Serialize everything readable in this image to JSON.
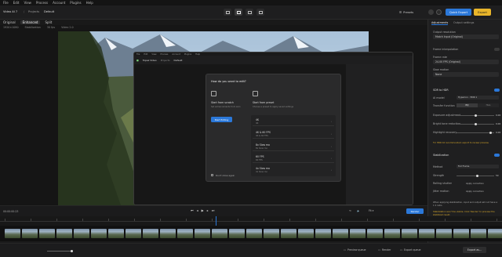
{
  "menubar": {
    "items": [
      "File",
      "Edit",
      "View",
      "Process",
      "Account",
      "Plugins",
      "Help"
    ]
  },
  "toolbar": {
    "project": "Video AI 7",
    "crumb_sep": "/",
    "crumb_projects": "Projects",
    "crumb_current": "Default",
    "presets_label": "Presets",
    "quick_export_label": "Quick Export",
    "export_label": "Export"
  },
  "subtabs": {
    "items": [
      "Original",
      "Enhanced",
      "Split"
    ]
  },
  "infobar": {
    "text": [
      "1920×1080",
      "Stabilization",
      "30 fps",
      "Video 2.0"
    ]
  },
  "sidebar": {
    "tabs": [
      "Adjustments",
      "Output settings"
    ],
    "output_resolution_label": "Output resolution",
    "output_resolution_value": "Match Input (Original)",
    "frame_interpolation_label": "Frame interpolation",
    "frame_rate_label": "Frame rate",
    "frame_rate_value": "24.00 FPS (Original)",
    "slow_motion_label": "Slow motion",
    "slow_motion_value": "None",
    "sdr_hdr_label": "SDR to HDR",
    "ai_model_label": "AI model",
    "ai_model_value": "Hyperion · HDR 1",
    "transfer_label": "Transfer function",
    "transfer_options": [
      "PQ",
      "HLG"
    ],
    "sliders": [
      {
        "label": "Exposure adjustment",
        "value": "0.00",
        "level": 0.5
      },
      {
        "label": "Bright tone reduction",
        "value": "0.00",
        "level": 0.5
      },
      {
        "label": "Highlight recovery",
        "value": "0.00",
        "level": 0.9
      }
    ],
    "hdr_note": "TV: HDR 10 recommended; export to review preview.",
    "stabilization_label": "Stabilization",
    "stab_method_label": "Method",
    "stab_method_value": "Full Frame",
    "strength_label": "Strength",
    "strength_value": "50",
    "strength_level": 0.55,
    "rolling_shutter_label": "Rolling shutter",
    "rolling_shutter_value": "Apply correction",
    "reduce_jitter_label": "Jitter motion",
    "reduce_jitter_value": "Apply correction",
    "warning_1": "When applying stabilization, input and output will not have a 1:1 ratio.",
    "warning_2": "Stabilization won't be visible. Click 'Render' to preview the stabilized result.",
    "motion_blur_label": "Motion deblur",
    "motion_model_label": "AI model",
    "motion_model_value": "Themis"
  },
  "transport": {
    "timecode": "00:00:00:23",
    "zoom": "Fit ▾",
    "render_label": "Render"
  },
  "bottombar": {
    "buttons": [
      "Preview queue",
      "Render",
      "Export queue"
    ],
    "export_label": "Export as…"
  },
  "inner_window": {
    "app_title": "Topaz Video",
    "menu": [
      "File",
      "Edit",
      "View",
      "Process",
      "Account",
      "Plugins",
      "Help"
    ],
    "crumb_projects": "Projects",
    "crumb_current": "Default"
  },
  "dialog": {
    "title": "How do you want to edit?",
    "scratch_title": "Start from scratch",
    "scratch_desc": "Set enhancements from zero",
    "scratch_button": "Start Editing",
    "preset_title": "Start from preset",
    "preset_desc": "Choose a preset to apply saved settings",
    "presets": [
      {
        "title": "4K",
        "sub": "4K"
      },
      {
        "title": "4K & 60 FPS",
        "sub": "4K & 60 FPS"
      },
      {
        "title": "8x Slow mo",
        "sub": "8x Slow mo"
      },
      {
        "title": "60 FPS",
        "sub": "60 FPS"
      },
      {
        "title": "4x Slow mo",
        "sub": "4x Slow mo"
      }
    ],
    "dont_show": "Don't show again"
  },
  "colors": {
    "accent": "#2b78d9",
    "export": "#e8b52a",
    "warning": "#d4a62a"
  }
}
